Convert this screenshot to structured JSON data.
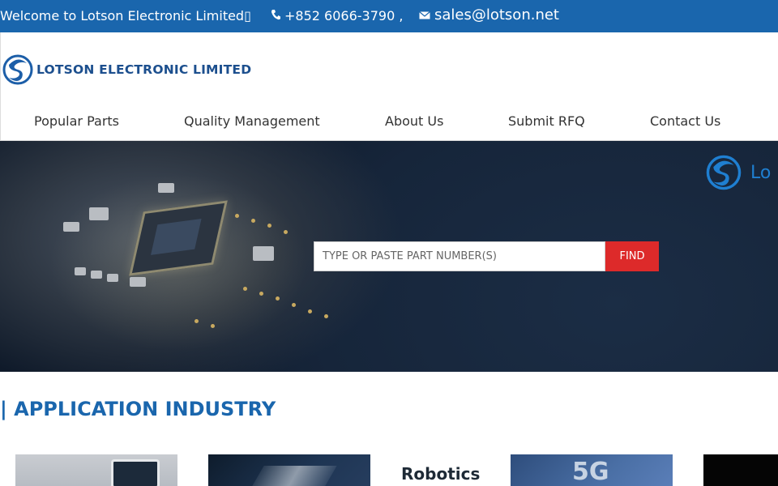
{
  "topbar": {
    "welcome": "Welcome to Lotson Electronic Limited▯",
    "phone": "+852 6066-3790 ,",
    "email": "sales@lotson.net",
    "background_color": "#1a66ad",
    "phone_icon": "phone-icon",
    "mail_icon": "mail-icon"
  },
  "header": {
    "logo_text": "LOTSON ELECTRONIC LIMITED",
    "brand_color": "#1c4f8e"
  },
  "nav": {
    "items": [
      {
        "label": "Popular Parts"
      },
      {
        "label": "Quality Management"
      },
      {
        "label": "About Us"
      },
      {
        "label": "Submit RFQ"
      },
      {
        "label": "Contact Us"
      }
    ]
  },
  "hero": {
    "logo_text": "Lo",
    "search_placeholder": "TYPE OR PASTE PART NUMBER(S)",
    "find_label": "FIND",
    "find_color": "#dd2a2a"
  },
  "industry": {
    "title": "| APPLICATION INDUSTRY",
    "title_color": "#1a66ad",
    "robotics_label": "Robotics",
    "fiveg_label": "5G"
  }
}
